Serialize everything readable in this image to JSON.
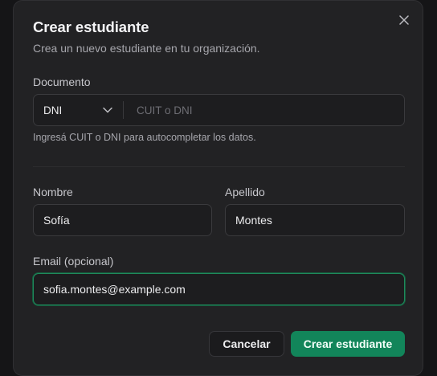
{
  "dialog": {
    "title": "Crear estudiante",
    "subtitle": "Crea un nuevo estudiante en tu organización.",
    "close_icon": "close-icon"
  },
  "document": {
    "label": "Documento",
    "type_value": "DNI",
    "input_placeholder": "CUIT o DNI",
    "input_value": "",
    "hint": "Ingresá CUIT o DNI para autocompletar los datos."
  },
  "nombre": {
    "label": "Nombre",
    "value": "Sofía"
  },
  "apellido": {
    "label": "Apellido",
    "value": "Montes"
  },
  "email": {
    "label": "Email (opcional)",
    "value": "sofia.montes@example.com"
  },
  "actions": {
    "cancel_label": "Cancelar",
    "submit_label": "Crear estudiante"
  },
  "colors": {
    "accent": "#12855a",
    "focus_ring": "#1f8a5c",
    "surface": "#222224"
  }
}
